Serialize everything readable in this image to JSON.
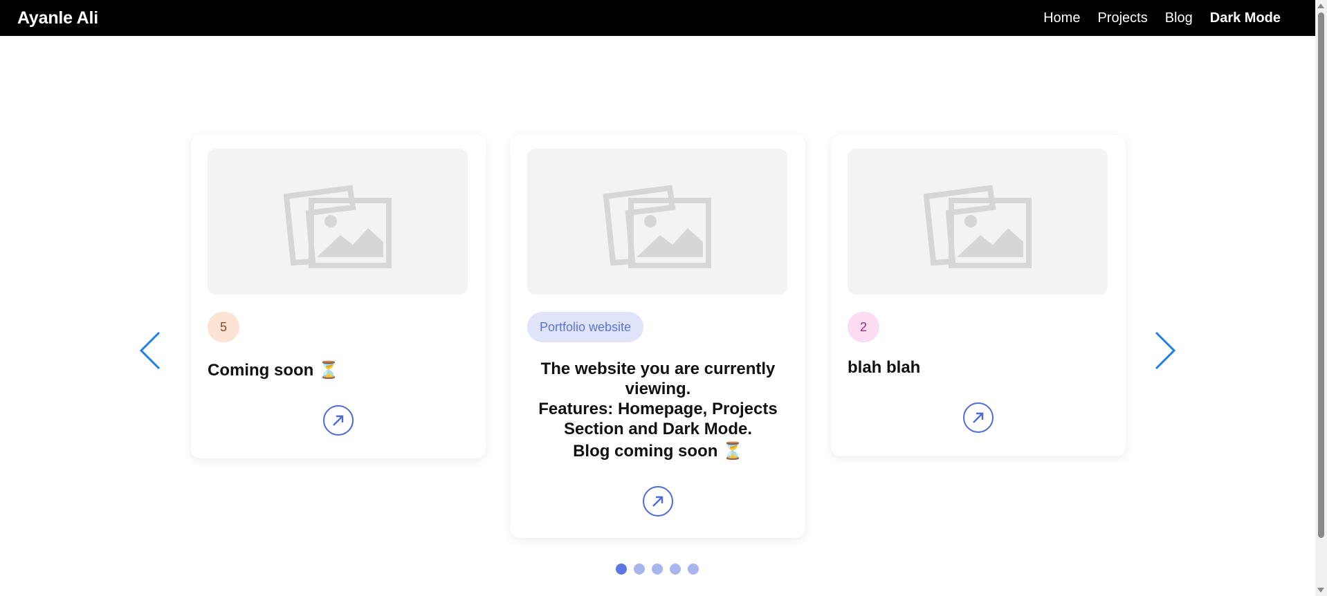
{
  "navbar": {
    "brand": "Ayanle Ali",
    "links": [
      {
        "label": "Home"
      },
      {
        "label": "Projects"
      },
      {
        "label": "Blog"
      },
      {
        "label": "Dark Mode"
      }
    ]
  },
  "carousel": {
    "cards": [
      {
        "badge": "5",
        "title": "Coming soon ⏳",
        "link_icon": "arrow-up-right-icon",
        "image_icon": "image-placeholder-icon"
      },
      {
        "badge": "Portfolio website",
        "title_lines": [
          "The website you are currently viewing.",
          "Features: Homepage, Projects Section and Dark Mode.",
          "Blog coming soon ⏳"
        ],
        "link_icon": "arrow-up-right-icon",
        "image_icon": "image-placeholder-icon"
      },
      {
        "badge": "2",
        "title": "blah blah",
        "link_icon": "arrow-up-right-icon",
        "image_icon": "image-placeholder-icon"
      }
    ],
    "prev_icon": "chevron-left-icon",
    "next_icon": "chevron-right-icon",
    "dots_count": 5,
    "active_dot": 1
  },
  "colors": {
    "accent": "#5d77e2",
    "arrow": "#1e7fe8",
    "navbar_bg": "#000000"
  }
}
